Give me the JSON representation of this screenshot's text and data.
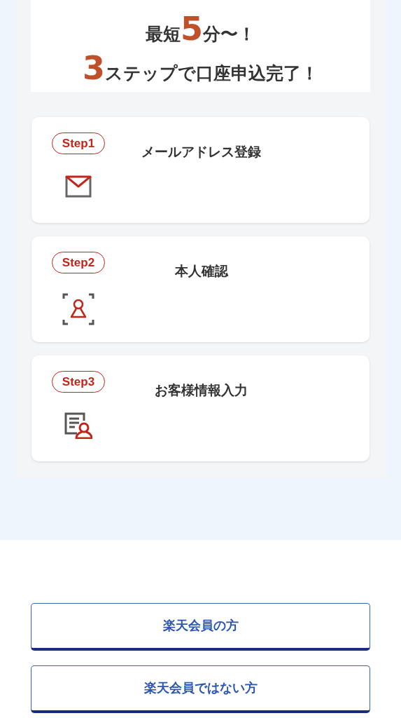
{
  "headline": {
    "lines": [
      [
        {
          "kind": "text",
          "text": "最短"
        },
        {
          "kind": "number",
          "text": "5"
        },
        {
          "kind": "text",
          "text": "分〜！"
        }
      ],
      [
        {
          "kind": "number",
          "text": "3"
        },
        {
          "kind": "text",
          "text": "ステップで口座申込完了！"
        }
      ]
    ]
  },
  "steps": [
    {
      "badge": "Step1",
      "title": "メールアドレス登録",
      "kind": "mail"
    },
    {
      "badge": "Step2",
      "title": "本人確認",
      "kind": "identity"
    },
    {
      "badge": "Step3",
      "title": "お客様情報入力",
      "kind": "profile"
    }
  ],
  "buttons": [
    "楽天会員の方",
    "楽天会員ではない方"
  ]
}
